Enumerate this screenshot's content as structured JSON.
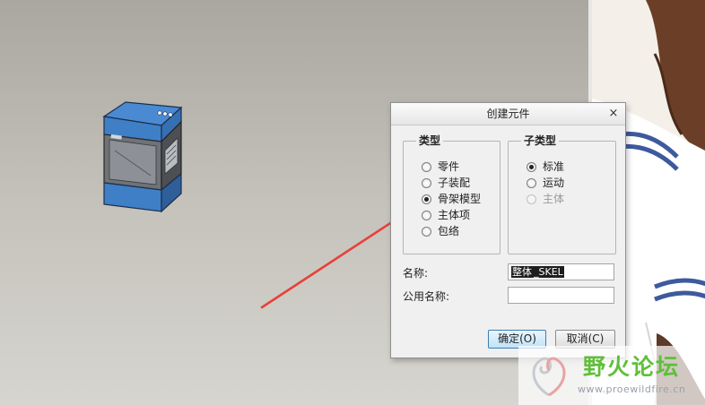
{
  "dialog": {
    "title": "创建元件",
    "close_label": "×",
    "type_group": {
      "title": "类型",
      "options": [
        {
          "label": "零件",
          "checked": false
        },
        {
          "label": "子装配",
          "checked": false
        },
        {
          "label": "骨架模型",
          "checked": true
        },
        {
          "label": "主体项",
          "checked": false
        },
        {
          "label": "包络",
          "checked": false
        }
      ]
    },
    "subtype_group": {
      "title": "子类型",
      "options": [
        {
          "label": "标准",
          "checked": true,
          "enabled": true
        },
        {
          "label": "运动",
          "checked": false,
          "enabled": true
        },
        {
          "label": "主体",
          "checked": false,
          "enabled": false
        }
      ]
    },
    "name_label": "名称:",
    "name_value_selected": "整体",
    "name_value_suffix": "_SKEL",
    "common_name_label": "公用名称:",
    "common_name_value": "",
    "ok_label": "确定(O)",
    "cancel_label": "取消(C)"
  },
  "watermark": {
    "title": "野火论坛",
    "url": "www.proewildfire.cn"
  },
  "colors": {
    "model_blue": "#3f7fc6",
    "model_dark": "#4a4a4a",
    "arrow_red": "#e8403a",
    "watermark_green": "#5fbf3a"
  }
}
